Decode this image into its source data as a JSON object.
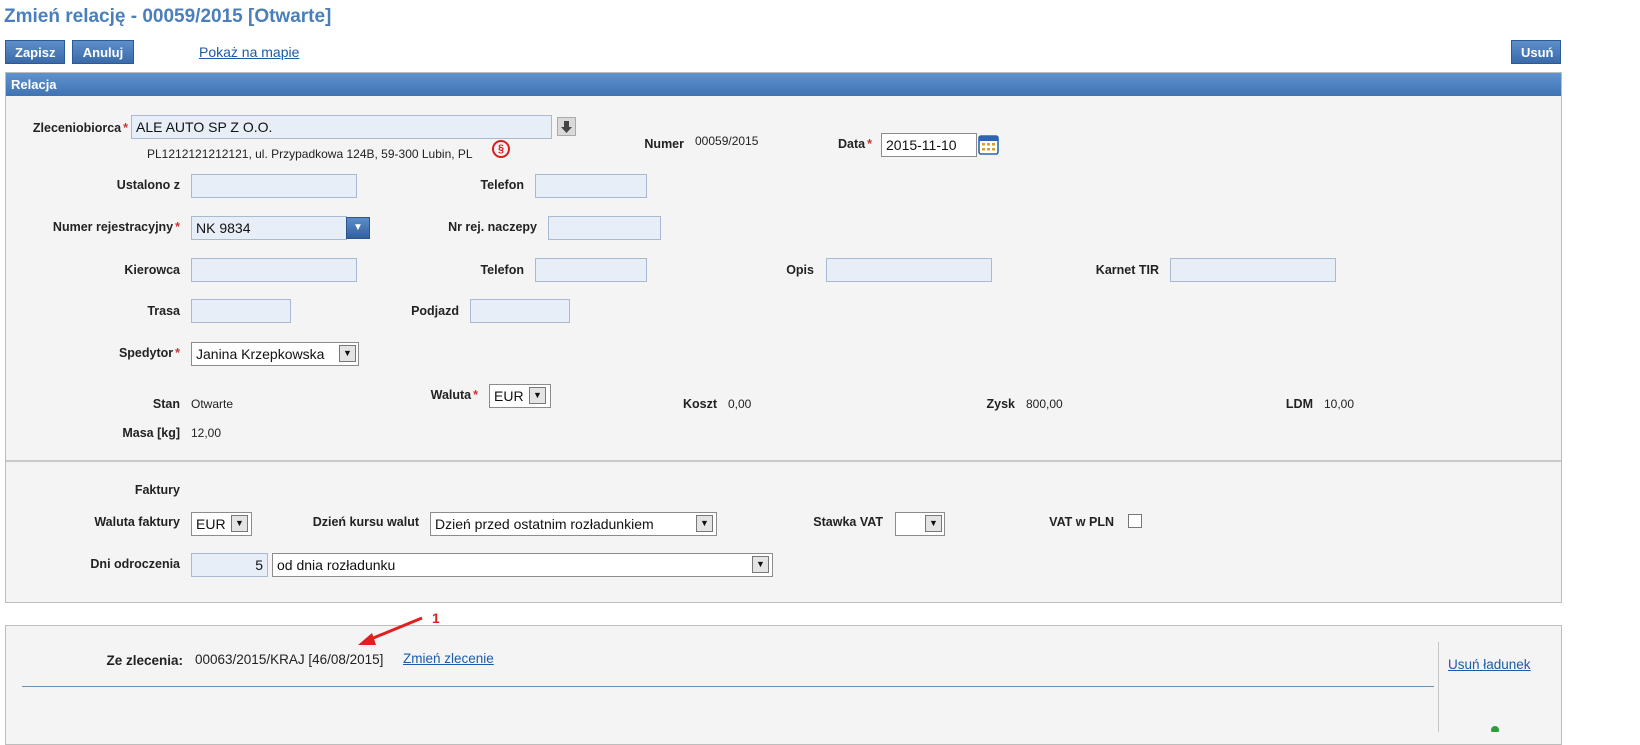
{
  "page": {
    "title": "Zmień relację - 00059/2015 [Otwarte]"
  },
  "toolbar": {
    "save_label": "Zapisz",
    "cancel_label": "Anuluj",
    "map_link": "Pokaż na mapie",
    "delete_label": "Usuń"
  },
  "relacja": {
    "header": "Relacja",
    "zleceniobiorca": {
      "label": "Zleceniobiorca",
      "value": "ALE AUTO SP Z O.O.",
      "address": "PL1212121212121, ul. Przypadkowa 124B, 59-300 Lubin, PL",
      "paragraph_symbol": "§"
    },
    "numer": {
      "label": "Numer",
      "value": "00059/2015"
    },
    "data": {
      "label": "Data",
      "value": "2015-11-10"
    },
    "ustalono_z": {
      "label": "Ustalono z",
      "value": ""
    },
    "telefon1": {
      "label": "Telefon",
      "value": ""
    },
    "numer_rej": {
      "label": "Numer rejestracyjny",
      "value": "NK 9834"
    },
    "nr_rej_naczepy": {
      "label": "Nr rej. naczepy",
      "value": ""
    },
    "kierowca": {
      "label": "Kierowca",
      "value": ""
    },
    "telefon2": {
      "label": "Telefon",
      "value": ""
    },
    "opis": {
      "label": "Opis",
      "value": ""
    },
    "karnet_tir": {
      "label": "Karnet TIR",
      "value": ""
    },
    "trasa": {
      "label": "Trasa",
      "value": ""
    },
    "podjazd": {
      "label": "Podjazd",
      "value": ""
    },
    "spedytor": {
      "label": "Spedytor",
      "value": "Janina Krzepkowska"
    },
    "stan": {
      "label": "Stan",
      "value": "Otwarte"
    },
    "waluta": {
      "label": "Waluta",
      "value": "EUR"
    },
    "koszt": {
      "label": "Koszt",
      "value": "0,00"
    },
    "zysk": {
      "label": "Zysk",
      "value": "800,00"
    },
    "ldm": {
      "label": "LDM",
      "value": "10,00"
    },
    "masa": {
      "label": "Masa [kg]",
      "value": "12,00"
    }
  },
  "faktury": {
    "heading": "Faktury",
    "waluta_faktury": {
      "label": "Waluta faktury",
      "value": "EUR"
    },
    "dzien_kursu": {
      "label": "Dzień kursu walut",
      "value": "Dzień przed ostatnim rozładunkiem"
    },
    "stawka_vat": {
      "label": "Stawka VAT",
      "value": ""
    },
    "vat_w_pln": {
      "label": "VAT w PLN",
      "checked": false
    },
    "dni_odroczenia": {
      "label": "Dni odroczenia",
      "value": "5",
      "option": "od dnia rozładunku"
    }
  },
  "zlecenie": {
    "label": "Ze zlecenia:",
    "value": "00063/2015/KRAJ [46/08/2015]",
    "change_link": "Zmień zlecenie",
    "remove_cargo_link": "Usuń ładunek",
    "annotation_number": "1"
  },
  "colors": {
    "accent": "#4a7fb9",
    "header_bar": "#4f82c1",
    "required": "#cc3333",
    "annotation": "#e02020"
  }
}
